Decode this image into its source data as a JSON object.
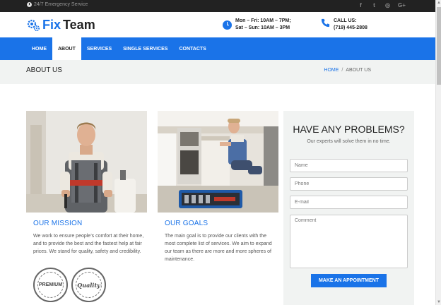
{
  "topbar": {
    "emergency_text": "24/7 Emergency Service",
    "socials": [
      {
        "icon": "facebook-icon",
        "glyph": "f"
      },
      {
        "icon": "twitter-icon",
        "glyph": "t"
      },
      {
        "icon": "instagram-icon",
        "glyph": "◎"
      },
      {
        "icon": "google-plus-icon",
        "glyph": "G+"
      }
    ]
  },
  "header": {
    "logo_fix": "Fix",
    "logo_team": "Team",
    "hours_line1": "Mon – Fri: 10AM – 7PM;",
    "hours_line2": "Sat – Sun: 10AM – 3PM",
    "call_label": "CALL US:",
    "call_number": "(719) 445-2808"
  },
  "nav": {
    "items": [
      "HOME",
      "ABOUT",
      "SERVICES",
      "SINGLE SERVICES",
      "CONTACTS"
    ],
    "active_index": 1
  },
  "page": {
    "title": "ABOUT US",
    "breadcrumb_home": "HOME",
    "breadcrumb_sep": "/",
    "breadcrumb_current": "ABOUT US"
  },
  "mission": {
    "title": "OUR MISSION",
    "text": "We work to ensure people’s comfort at their home, and to provide the best and the fastest help at fair prices. We stand for quality, safety and credibility."
  },
  "goals": {
    "title": "OUR GOALS",
    "text": "The main goal is to provide our clients with the most complete list of services. We aim to expand our team as there are more and more spheres of maintenance."
  },
  "badges": {
    "premium": "PREMIUM",
    "quality": "Quality"
  },
  "form": {
    "heading": "HAVE ANY PROBLEMS?",
    "subheading": "Our experts will solve them in no time.",
    "name_placeholder": "Name",
    "phone_placeholder": "Phone",
    "email_placeholder": "E-mail",
    "comment_placeholder": "Comment",
    "submit_label": "MAKE AN APPOINTMENT"
  },
  "colors": {
    "accent": "#1a73e8",
    "topbar": "#222222",
    "band": "#f1f3f2"
  }
}
